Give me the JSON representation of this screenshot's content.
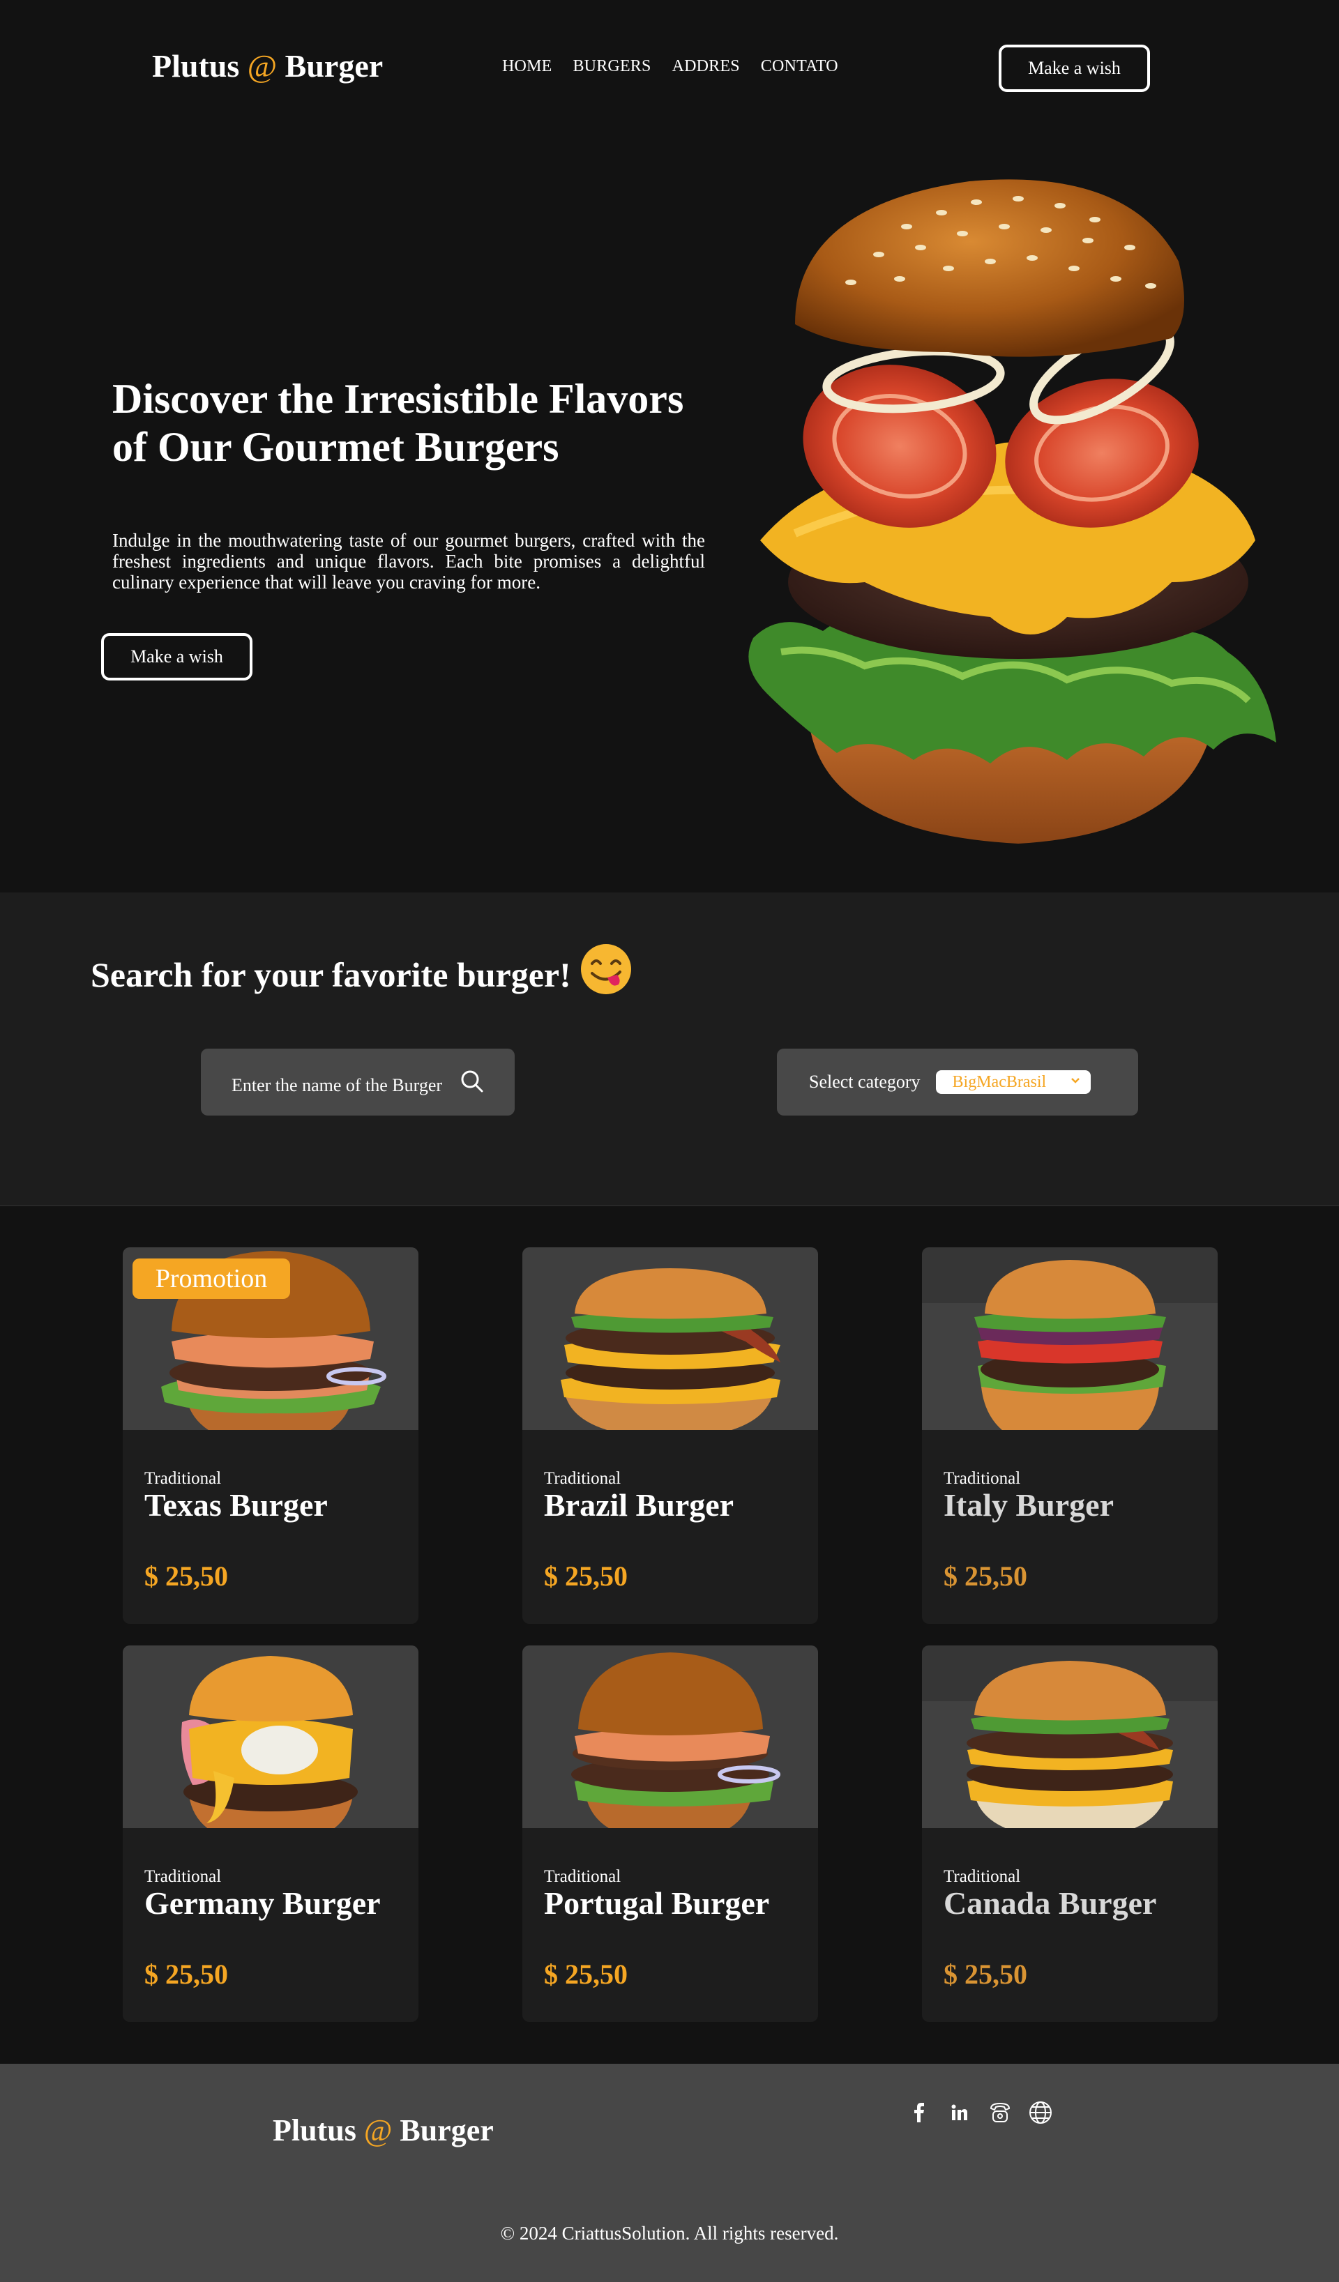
{
  "brand": {
    "name_start": "Plutus",
    "at": "@",
    "name_end": "Burger"
  },
  "nav": {
    "items": [
      "HOME",
      "BURGERS",
      "ADDRES",
      "CONTATO"
    ]
  },
  "header": {
    "cta_label": "Make a wish"
  },
  "hero": {
    "title": "Discover the Irresistible Flavors of Our Gourmet Burgers",
    "description": "Indulge in the mouthwatering taste of our gourmet burgers, crafted with the freshest ingredients and unique flavors. Each bite promises a delightful culinary experience that will leave you craving for more.",
    "cta_label": "Make a wish"
  },
  "search": {
    "title": "Search for your favorite burger!",
    "input_placeholder": "Enter the name of the Burger",
    "category_label": "Select category",
    "category_selected": "BigMacBrasil"
  },
  "menu": {
    "promotion_badge": "Promotion",
    "cards": [
      {
        "type": "Traditional",
        "name": "Texas Burger",
        "price": "$ 25,50"
      },
      {
        "type": "Traditional",
        "name": "Brazil Burger",
        "price": "$ 25,50"
      },
      {
        "type": "Traditional",
        "name": "Italy Burger",
        "price": "$ 25,50"
      },
      {
        "type": "Traditional",
        "name": "Germany Burger",
        "price": "$ 25,50"
      },
      {
        "type": "Traditional",
        "name": "Portugal Burger",
        "price": "$ 25,50"
      },
      {
        "type": "Traditional",
        "name": "Canada Burger",
        "price": "$ 25,50"
      }
    ]
  },
  "footer": {
    "social_icons": [
      "facebook-icon",
      "linkedin-icon",
      "phone-icon",
      "globe-icon"
    ],
    "copyright": "© 2024 CriattusSolution. All rights reserved."
  },
  "colors": {
    "accent": "#f5a623",
    "background": "#121212",
    "panel": "#1d1d1d",
    "input": "#484848",
    "footer": "#474747"
  }
}
